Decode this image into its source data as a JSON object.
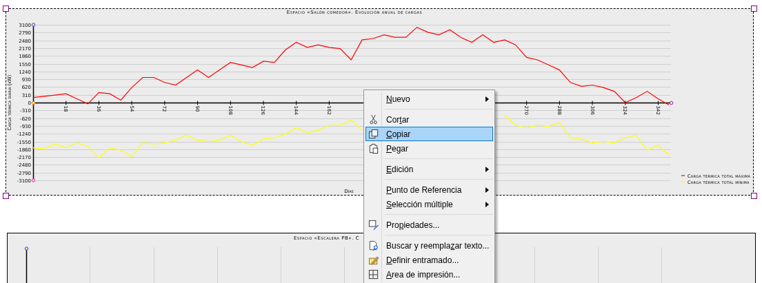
{
  "top_chart": {
    "title": "Espacio «Salón comedor». Evolución anual de cargas",
    "chart_data": {
      "type": "line",
      "xlabel": "Días",
      "ylabel": "Carga térmica diaria (kW)",
      "x": [
        0,
        6,
        12,
        18,
        24,
        30,
        36,
        42,
        48,
        54,
        60,
        66,
        72,
        78,
        84,
        90,
        96,
        102,
        108,
        114,
        120,
        126,
        132,
        138,
        144,
        150,
        156,
        162,
        168,
        174,
        180,
        186,
        192,
        198,
        204,
        210,
        216,
        222,
        228,
        234,
        240,
        246,
        252,
        258,
        264,
        270,
        276,
        282,
        288,
        294,
        300,
        306,
        312,
        318,
        324,
        330,
        336,
        342,
        348
      ],
      "series": [
        {
          "name": "Carga térmica total máxima",
          "color": "#ff0000",
          "values": [
            200,
            250,
            300,
            350,
            150,
            -50,
            400,
            350,
            100,
            600,
            1000,
            1000,
            800,
            700,
            1000,
            1300,
            1000,
            1300,
            1600,
            1500,
            1400,
            1650,
            1600,
            2100,
            2400,
            2200,
            2300,
            2200,
            2150,
            1700,
            2500,
            2550,
            2700,
            2600,
            2600,
            3000,
            2800,
            2700,
            2900,
            2600,
            2400,
            2700,
            2400,
            2500,
            2300,
            1800,
            1700,
            1500,
            1300,
            800,
            650,
            700,
            600,
            450,
            0,
            200,
            450,
            150,
            -100
          ]
        },
        {
          "name": "Carga térmica total mínima",
          "color": "#ffff00",
          "values": [
            -1800,
            -1850,
            -1650,
            -1800,
            -1600,
            -1750,
            -2200,
            -1800,
            -1900,
            -2150,
            -1600,
            -1650,
            -1600,
            -1500,
            -1300,
            -1500,
            -1550,
            -1500,
            -1300,
            -1550,
            -1700,
            -1450,
            -1400,
            -1250,
            -1000,
            -1200,
            -1100,
            -900,
            -900,
            -700,
            -1100,
            null,
            null,
            null,
            null,
            null,
            null,
            null,
            null,
            null,
            null,
            null,
            null,
            -500,
            -900,
            -1000,
            -900,
            -950,
            -800,
            -1400,
            -1450,
            -1600,
            -1550,
            -1600,
            -1400,
            -1300,
            -1900,
            -1700,
            -2100
          ]
        }
      ],
      "grid": true,
      "legend": "right",
      "xlim": [
        0,
        349
      ],
      "ylim": [
        -3100,
        3100
      ],
      "xticks": [
        18,
        36,
        54,
        72,
        90,
        108,
        126,
        144,
        162,
        270,
        288,
        306,
        324,
        342
      ],
      "yticks": [
        3100,
        2790,
        2480,
        2170,
        1860,
        1550,
        1240,
        930,
        620,
        310,
        0,
        -310,
        -620,
        -930,
        -1240,
        -1550,
        -1860,
        -2170,
        -2480,
        -2790,
        -3100
      ]
    }
  },
  "bottom_chart": {
    "title": "Espacio «Escalera PB». C"
  },
  "context_menu": [
    {
      "kind": "item",
      "label": {
        "key": "N",
        "post": "uevo"
      },
      "submenu": true,
      "selected": false
    },
    {
      "kind": "separator"
    },
    {
      "kind": "item",
      "label": {
        "pre": "Cor",
        "key": "t",
        "post": "ar"
      },
      "submenu": false,
      "selected": false
    },
    {
      "kind": "item",
      "label": {
        "key": "C",
        "post": "opiar"
      },
      "submenu": false,
      "selected": true
    },
    {
      "kind": "item",
      "label": {
        "key": "P",
        "post": "egar"
      },
      "submenu": false,
      "selected": false
    },
    {
      "kind": "separator"
    },
    {
      "kind": "item",
      "label": {
        "key": "E",
        "post": "dición"
      },
      "submenu": true,
      "selected": false
    },
    {
      "kind": "separator"
    },
    {
      "kind": "item",
      "label": {
        "key": "P",
        "post": "unto de Referencia"
      },
      "submenu": true,
      "selected": false
    },
    {
      "kind": "item",
      "label": {
        "key": "S",
        "post": "elección múltiple"
      },
      "submenu": true,
      "selected": false
    },
    {
      "kind": "separator"
    },
    {
      "kind": "item",
      "label": {
        "pre": "Pro",
        "key": "p",
        "post": "iedades..."
      },
      "submenu": false,
      "selected": false
    },
    {
      "kind": "separator"
    },
    {
      "kind": "item",
      "label": {
        "pre": "Buscar y reempla",
        "key": "z",
        "post": "ar texto..."
      },
      "submenu": false,
      "selected": false
    },
    {
      "kind": "item",
      "label": {
        "key": "D",
        "post": "efinir entramado..."
      },
      "submenu": false,
      "selected": false
    },
    {
      "kind": "item",
      "label": {
        "key": "A",
        "post": "rea de impresión..."
      },
      "submenu": false,
      "selected": false
    }
  ]
}
